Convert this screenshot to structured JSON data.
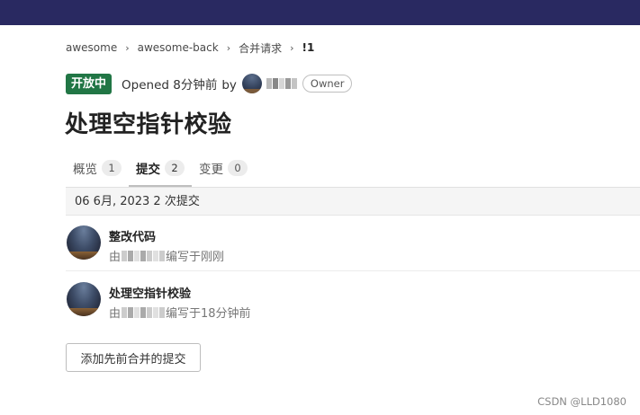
{
  "breadcrumb": [
    {
      "label": "awesome"
    },
    {
      "label": "awesome-back"
    },
    {
      "label": "合并请求"
    },
    {
      "label": "!1"
    }
  ],
  "merge_request": {
    "status": "开放中",
    "opened_text": "Opened 8分钟前",
    "by_text": "by",
    "author_role": "Owner",
    "title": "处理空指针校验"
  },
  "tabs": [
    {
      "label": "概览",
      "count": "1",
      "active": false
    },
    {
      "label": "提交",
      "count": "2",
      "active": true
    },
    {
      "label": "变更",
      "count": "0",
      "active": false
    }
  ],
  "commits_section": {
    "date_header": "06 6月, 2023 2 次提交",
    "commits": [
      {
        "message": "整改代码",
        "author_prefix": "由",
        "author_suffix": "编写于刚刚"
      },
      {
        "message": "处理空指针校验",
        "author_prefix": "由",
        "author_suffix": "编写于18分钟前"
      }
    ]
  },
  "actions": {
    "add_previous_commits_label": "添加先前合并的提交"
  },
  "watermark": "CSDN @LLD1080",
  "colors": {
    "topbar": "#292961",
    "status_open": "#217645"
  }
}
